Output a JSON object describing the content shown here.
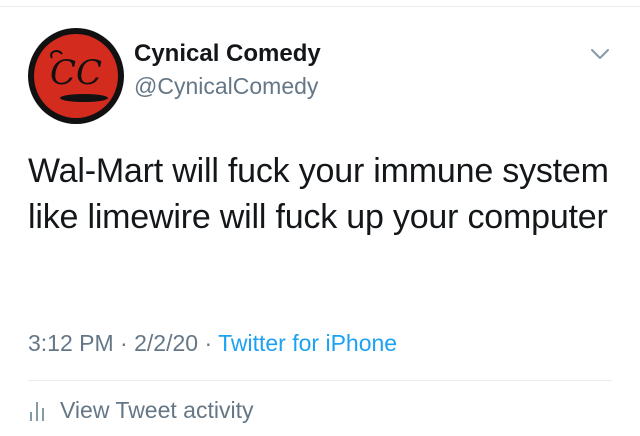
{
  "tweet": {
    "display_name": "Cynical Comedy",
    "handle": "@CynicalComedy",
    "avatar": {
      "initials": "CC",
      "colors": {
        "ring": "#111111",
        "fill": "#d32b1e",
        "text": "#111111"
      }
    },
    "text": "Wal-Mart will fuck your immune system like limewire will fuck up your computer",
    "time": "3:12 PM",
    "separator": "·",
    "date": "2/2/20",
    "source": "Twitter for iPhone"
  },
  "actions": {
    "activity_label": "View Tweet activity",
    "activity_icon": "bar-chart-icon",
    "menu_icon": "chevron-down-icon"
  },
  "colors": {
    "text": "#14171a",
    "secondary": "#657786",
    "link": "#1da1f2",
    "divider": "#e6ecf0"
  }
}
